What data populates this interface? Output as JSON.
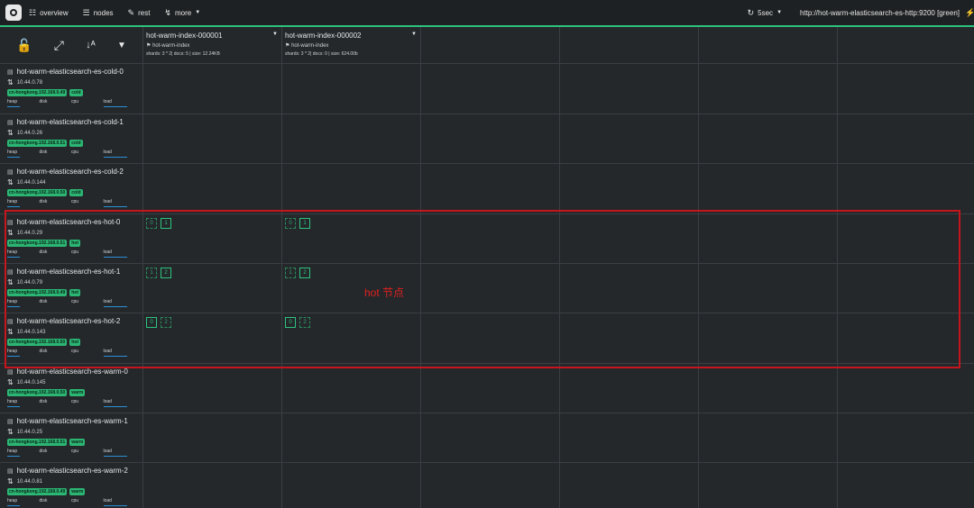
{
  "topbar": {
    "logo": "logo-icon",
    "nav": [
      {
        "label": "overview",
        "icon": "sitemap-icon"
      },
      {
        "label": "nodes",
        "icon": "list-icon"
      },
      {
        "label": "rest",
        "icon": "edit-icon"
      },
      {
        "label": "more",
        "icon": "wrench-icon"
      }
    ],
    "refresh": {
      "label": "5sec",
      "icon": "refresh-icon"
    },
    "url": "http://hot-warm-elasticsearch-es-http:9200 [green]",
    "accent": "#2ec27e"
  },
  "controls": {
    "lock": "unlock-icon",
    "expand": "expand-icon",
    "sort": "sort-az-icon",
    "menu": "caret-down-icon"
  },
  "indices": [
    {
      "name": "hot-warm-index-000001",
      "alias": "hot-warm-index",
      "stats": "shards: 3 * 2| docs: 5 | size: 12.24KB"
    },
    {
      "name": "hot-warm-index-000002",
      "alias": "hot-warm-index",
      "stats": "shards: 3 * 2| docs: 0 | size: 624.00b"
    }
  ],
  "metric_labels": [
    "heap",
    "disk",
    "cpu",
    "load"
  ],
  "nodes": [
    {
      "name": "hot-warm-elasticsearch-es-cold-0",
      "ip": "10.44.0.78",
      "zone": "cn-hongkong.192.168.0.49",
      "tier": "cold"
    },
    {
      "name": "hot-warm-elasticsearch-es-cold-1",
      "ip": "10.44.0.26",
      "zone": "cn-hongkong.192.168.0.51",
      "tier": "cold"
    },
    {
      "name": "hot-warm-elasticsearch-es-cold-2",
      "ip": "10.44.0.144",
      "zone": "cn-hongkong.192.168.0.50",
      "tier": "cold"
    },
    {
      "name": "hot-warm-elasticsearch-es-hot-0",
      "ip": "10.44.0.29",
      "zone": "cn-hongkong.192.168.0.51",
      "tier": "hot"
    },
    {
      "name": "hot-warm-elasticsearch-es-hot-1",
      "ip": "10.44.0.79",
      "zone": "cn-hongkong.192.168.0.49",
      "tier": "hot"
    },
    {
      "name": "hot-warm-elasticsearch-es-hot-2",
      "ip": "10.44.0.143",
      "zone": "cn-hongkong.192.168.0.50",
      "tier": "hot"
    },
    {
      "name": "hot-warm-elasticsearch-es-warm-0",
      "ip": "10.44.0.145",
      "zone": "cn-hongkong.192.168.0.50",
      "tier": "warm"
    },
    {
      "name": "hot-warm-elasticsearch-es-warm-1",
      "ip": "10.44.0.25",
      "zone": "cn-hongkong.192.168.0.51",
      "tier": "warm"
    },
    {
      "name": "hot-warm-elasticsearch-es-warm-2",
      "ip": "10.44.0.81",
      "zone": "cn-hongkong.192.168.0.49",
      "tier": "warm"
    }
  ],
  "shards": {
    "hot0": {
      "idx1": [
        "0",
        "1"
      ],
      "idx2": [
        "0",
        "1"
      ]
    },
    "hot1": {
      "idx1": [
        "1",
        "2"
      ],
      "idx2": [
        "1",
        "2"
      ]
    },
    "hot2": {
      "idx1": [
        "0",
        "2"
      ],
      "idx2": [
        "0",
        "2"
      ]
    }
  },
  "annotation": {
    "label": "hot 节点",
    "color": "#c4161c"
  }
}
